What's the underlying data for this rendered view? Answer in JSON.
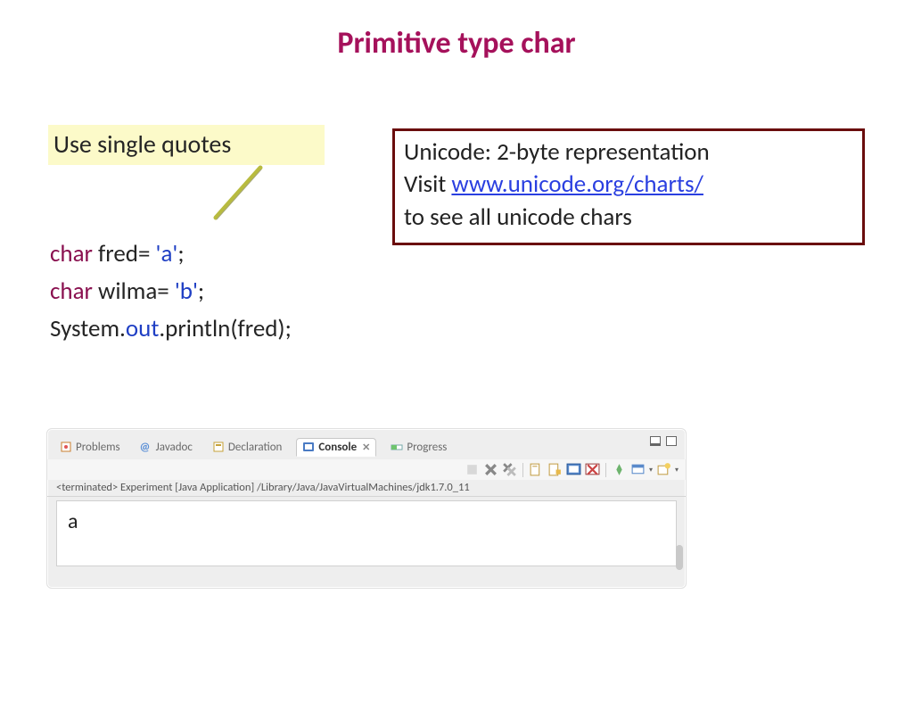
{
  "title": "Primitive type char",
  "highlight": "Use single quotes",
  "code": {
    "kw1": "char",
    "line1_mid": " fred= ",
    "lit1": "'a'",
    "line1_end": ";",
    "kw2": "char",
    "line2_mid": " wilma= ",
    "lit2": "'b'",
    "line2_end": ";",
    "line3_a": "System.",
    "line3_b": "out",
    "line3_c": ".println(fred);"
  },
  "info": {
    "line1": "Unicode: 2-byte representation",
    "line2a": "Visit  ",
    "link": "www.unicode.org/charts/",
    "line3": "to see all unicode chars"
  },
  "eclipse": {
    "tabs": {
      "problems": "Problems",
      "javadoc": "Javadoc",
      "declaration": "Declaration",
      "console": "Console",
      "progress": "Progress"
    },
    "close_x": "✕",
    "status": "<terminated> Experiment [Java Application] /Library/Java/JavaVirtualMachines/jdk1.7.0_11",
    "output": "a"
  }
}
